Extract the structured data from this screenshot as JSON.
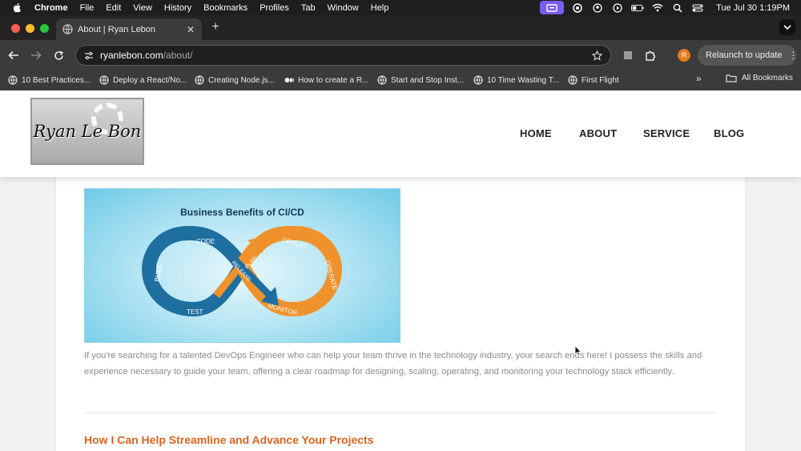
{
  "menubar": {
    "app_name": "Chrome",
    "items": [
      "File",
      "Edit",
      "View",
      "History",
      "Bookmarks",
      "Profiles",
      "Tab",
      "Window",
      "Help"
    ],
    "clock": "Tue Jul 30  1:19PM"
  },
  "browser": {
    "tab": {
      "title": "About | Ryan Lebon",
      "close": "✕"
    },
    "new_tab": "+",
    "url": {
      "host": "ryanlebon.com",
      "path": "/about/"
    },
    "avatar_letter": "R",
    "relaunch_label": "Relaunch to update",
    "relaunch_menu": "⋮",
    "bookmarks": [
      "10 Best Practices...",
      "Deploy a React/No...",
      "Creating Node.js...",
      "How to create a R...",
      "Start and Stop Inst...",
      "10 Time Wasting T...",
      "First Flight"
    ],
    "bookmarks_more": "»",
    "all_bookmarks": "All Bookmarks"
  },
  "site": {
    "logo_text": "Ryan Le Bon",
    "nav": [
      "HOME",
      "ABOUT",
      "SERVICE",
      "BLOG"
    ],
    "hero": {
      "title": "Business Benefits of CI/CD",
      "stages": [
        "CODE",
        "BUILD",
        "TEST",
        "RELEASE",
        "PLAN",
        "DEPLOY",
        "OPERATE",
        "MONITOR"
      ]
    },
    "intro_paragraph": "If you're searching for a talented DevOps Engineer who can help your team thrive in the technology industry, your search ends here! I possess the skills and experience necessary to guide your team, offering a clear roadmap for designing, scaling, operating, and monitoring your technology stack efficiently.",
    "section_heading": "How I Can Help Streamline and Advance Your Projects"
  },
  "colors": {
    "accent_heading": "#d8641f",
    "loop_blue": "#1e6f9f",
    "loop_orange": "#f0922b",
    "menubar_highlight": "#7a5cf0"
  }
}
